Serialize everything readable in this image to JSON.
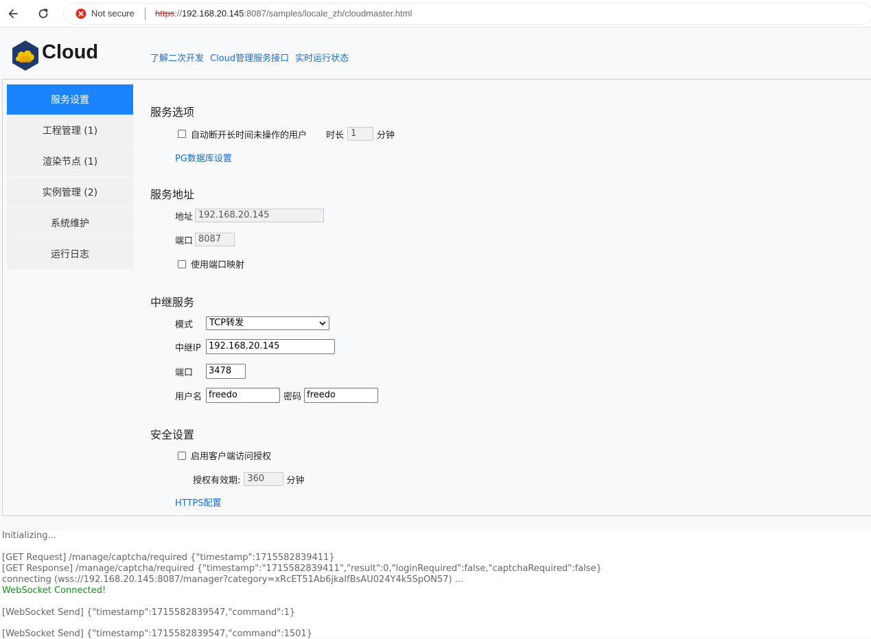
{
  "browser": {
    "security_text": "Not secure",
    "url_scheme": "https",
    "url_sep": "://",
    "url_host": "192.168.20.145",
    "url_rest": ":8087/samples/locale_zh/cloudmaster.html"
  },
  "header": {
    "logo_text": "Cloud",
    "links": [
      "了解二次开发",
      "Cloud管理服务接口",
      "实时运行状态"
    ]
  },
  "sidebar": {
    "items": [
      {
        "label": "服务设置",
        "active": true
      },
      {
        "label": "工程管理 (1)"
      },
      {
        "label": "渲染节点 (1)"
      },
      {
        "label": "实例管理 (2)"
      },
      {
        "label": "系统维护"
      },
      {
        "label": "运行日志"
      }
    ]
  },
  "service_options": {
    "title": "服务选项",
    "auto_disconnect_label": "自动断开长时间未操作的用户",
    "duration_label": "时长",
    "duration_value": "1",
    "minutes_label": "分钟",
    "pg_link": "PG数据库设置"
  },
  "service_address": {
    "title": "服务地址",
    "address_label": "地址",
    "address_value": "192.168.20.145",
    "port_label": "端口",
    "port_value": "8087",
    "port_mapping_label": "使用端口映射"
  },
  "relay": {
    "title": "中继服务",
    "mode_label": "模式",
    "mode_value": "TCP转发",
    "ip_label": "中继IP",
    "ip_value": "192.168.20.145",
    "port_label": "端口",
    "port_value": "3478",
    "username_label": "用户名",
    "username_value": "freedo",
    "password_label": "密码",
    "password_value": "freedo"
  },
  "security": {
    "title": "安全设置",
    "client_auth_label": "启用客户端访问授权",
    "validity_label": "授权有效期:",
    "validity_value": "360",
    "minutes_label": "分钟",
    "https_link": "HTTPS配置"
  },
  "log": {
    "lines": [
      "Initializing...",
      "[GET Request] /manage/captcha/required {\"timestamp\":1715582839411}",
      "[GET Response] /manage/captcha/required {\"timestamp\":\"1715582839411\",\"result\":0,\"loginRequired\":false,\"captchaRequired\":false}",
      "connecting (wss://192.168.20.145:8087/manager?category=xRcET51Ab6jkaIfBsAU024Y4k5SpON57) ...",
      "WebSocket Connected!",
      "[WebSocket Send] {\"timestamp\":1715582839547,\"command\":1}",
      "[WebSocket Send] {\"timestamp\":1715582839547,\"command\":1501}"
    ]
  }
}
